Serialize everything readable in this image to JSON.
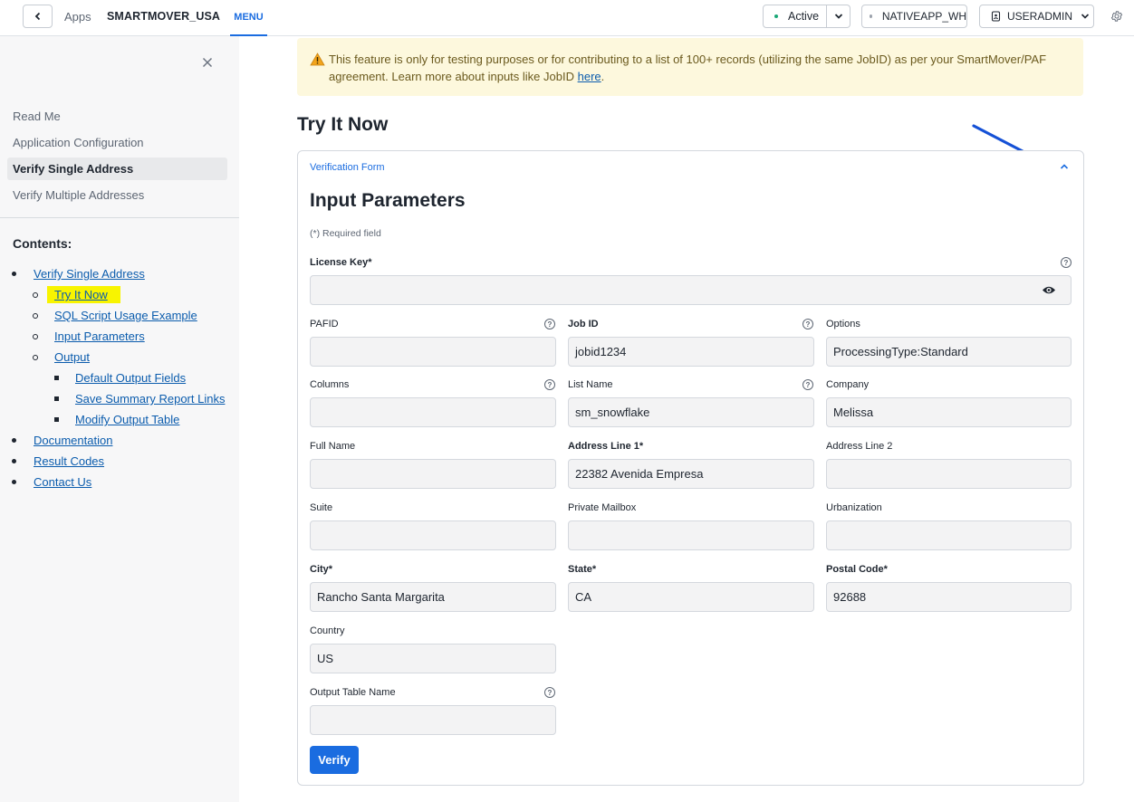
{
  "topbar": {
    "apps_label": "Apps",
    "app_name": "SMARTMOVER_USA",
    "menu_label": "MENU",
    "status_label": "Active",
    "status_color": "#1aa876",
    "warehouse_label": "NATIVEAPP_WH",
    "warehouse_dot_color": "#9aa1ab",
    "role_label": "USERADMIN"
  },
  "sidebar": {
    "nav": [
      {
        "label": "Read Me"
      },
      {
        "label": "Application Configuration"
      },
      {
        "label": "Verify Single Address"
      },
      {
        "label": "Verify Multiple Addresses"
      }
    ],
    "contents_title": "Contents:",
    "toc": [
      {
        "label": "Verify Single Address"
      },
      {
        "label": "Try It Now"
      },
      {
        "label": "SQL Script Usage Example"
      },
      {
        "label": "Input Parameters"
      },
      {
        "label": "Output"
      },
      {
        "label": "Default Output Fields"
      },
      {
        "label": "Save Summary Report Links"
      },
      {
        "label": "Modify Output Table"
      },
      {
        "label": "Documentation"
      },
      {
        "label": "Result Codes"
      },
      {
        "label": "Contact Us"
      }
    ]
  },
  "main": {
    "warning_text": "This feature is only for testing purposes or for contributing to a list of 100+ records (utilizing the same JobID) as per your SmartMover/PAF agreement. Learn more about inputs like JobID ",
    "warning_link": "here",
    "warning_end": ".",
    "page_title": "Try It Now",
    "form_section_label": "Verification Form",
    "form_title": "Input Parameters",
    "required_note": "(*) Required field",
    "fields": {
      "license_key": {
        "label": "License Key",
        "req": "*",
        "value": ""
      },
      "pafid": {
        "label": "PAFID",
        "value": ""
      },
      "job_id": {
        "label": "Job ID",
        "value": "jobid1234"
      },
      "options": {
        "label": "Options",
        "value": "ProcessingType:Standard"
      },
      "columns": {
        "label": "Columns",
        "value": ""
      },
      "list_name": {
        "label": "List Name",
        "value": "sm_snowflake"
      },
      "company": {
        "label": "Company",
        "value": "Melissa"
      },
      "full_name": {
        "label": "Full Name",
        "value": ""
      },
      "address_line_1": {
        "label": "Address Line 1",
        "req": "*",
        "value": "22382 Avenida Empresa"
      },
      "address_line_2": {
        "label": "Address Line 2",
        "value": ""
      },
      "suite": {
        "label": "Suite",
        "value": ""
      },
      "private_mailbox": {
        "label": "Private Mailbox",
        "value": ""
      },
      "urbanization": {
        "label": "Urbanization",
        "value": ""
      },
      "city": {
        "label": "City",
        "req": "*",
        "value": "Rancho Santa Margarita"
      },
      "state": {
        "label": "State",
        "req": "*",
        "value": "CA"
      },
      "postal_code": {
        "label": "Postal Code",
        "req": "*",
        "value": "92688"
      },
      "country": {
        "label": "Country",
        "value": "US"
      },
      "output_table_name": {
        "label": "Output Table Name",
        "value": ""
      }
    },
    "help_glyph": "?",
    "verify_label": "Verify",
    "accent_color": "#1a6ce0"
  }
}
